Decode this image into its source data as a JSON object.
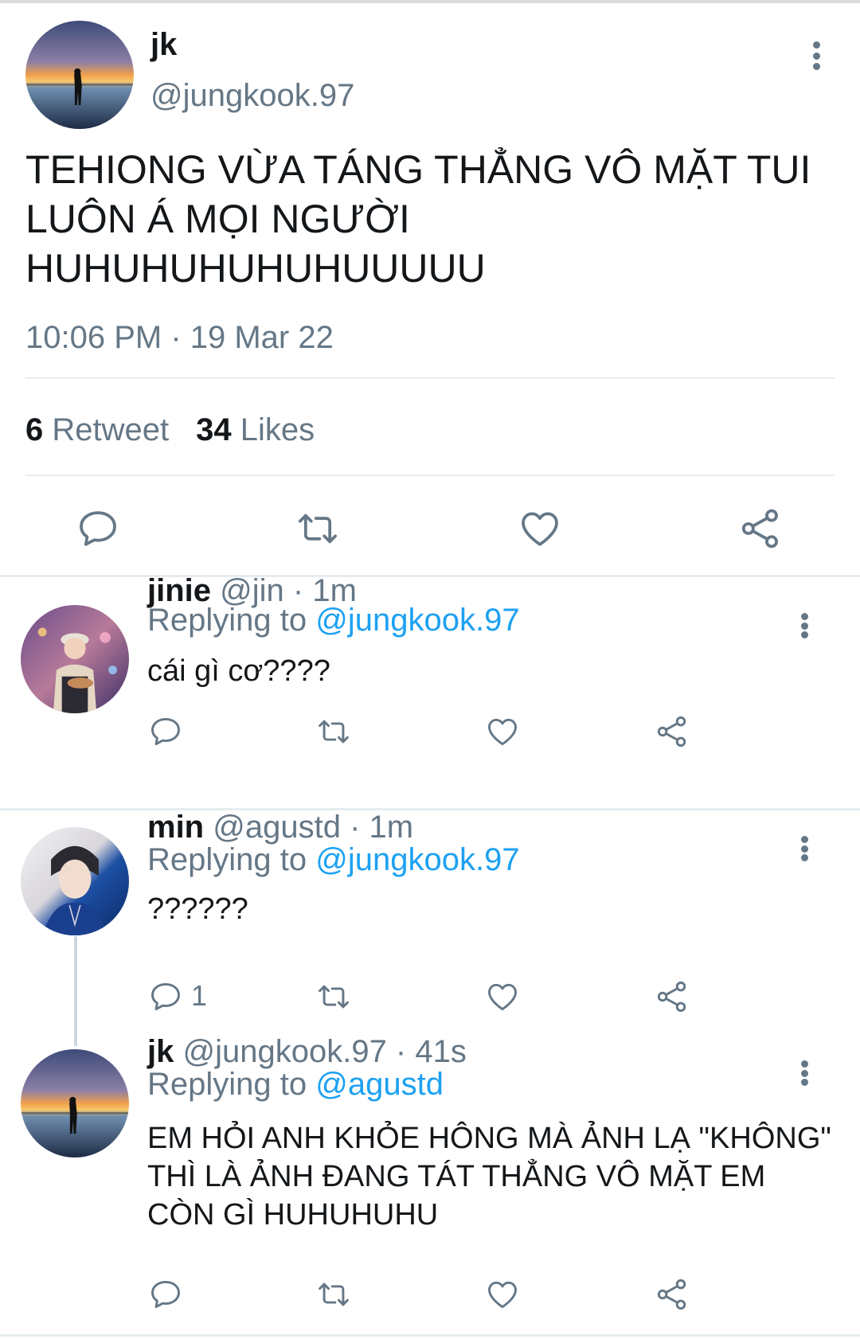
{
  "main_tweet": {
    "name": "jk",
    "handle": "@jungkook.97",
    "text": "TEHIONG VỪA TÁNG THẲNG VÔ MẶT TUI LUÔN Á MỌI NGƯỜI HUHUHUHUHUHUUUUU",
    "timestamp": "10:06 PM · 19 Mar 22",
    "retweet_count": "6",
    "retweet_label": "Retweet",
    "like_count": "34",
    "like_label": "Likes",
    "actions": [
      "reply-icon",
      "retweet-icon",
      "like-icon",
      "share-icon"
    ]
  },
  "replies": [
    {
      "name": "jinie",
      "meta": "@jin · 1m",
      "replying_prefix": "Replying to",
      "replying_to": "@jungkook.97",
      "text": "cái gì cơ????",
      "reply_count": ""
    },
    {
      "name": "min",
      "meta": "@agustd · 1m",
      "replying_prefix": "Replying to",
      "replying_to": "@jungkook.97",
      "text": "??????",
      "reply_count": "1"
    },
    {
      "name": "jk",
      "meta": "@jungkook.97 · 41s",
      "replying_prefix": "Replying to",
      "replying_to": "@agustd",
      "text": "EM HỎI ANH KHỎE HÔNG MÀ ẢNH LẠ \"KHÔNG\" THÌ LÀ ẢNH ĐANG TÁT THẲNG VÔ MẶT EM CÒN GÌ HUHUHUHU",
      "reply_count": ""
    }
  ],
  "colors": {
    "text": "#14171a",
    "secondary": "#657786",
    "link": "#1da1f2",
    "divider": "#e6ecf0"
  }
}
